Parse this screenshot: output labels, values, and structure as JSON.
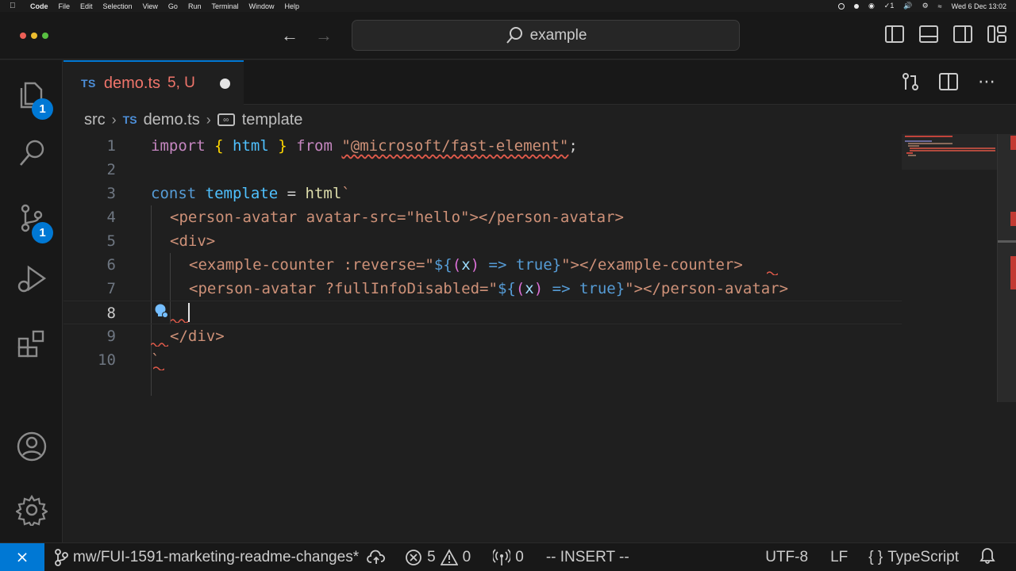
{
  "menubar": {
    "items": [
      "Code",
      "File",
      "Edit",
      "Selection",
      "View",
      "Go",
      "Run",
      "Terminal",
      "Window",
      "Help"
    ],
    "count_badge": "1",
    "datetime": "Wed 6 Dec  13:02"
  },
  "titlebar": {
    "search_text": "example"
  },
  "activity": {
    "explorer_badge": "1",
    "scm_badge": "1"
  },
  "tab": {
    "lang": "TS",
    "filename": "demo.ts",
    "status": "5, U"
  },
  "breadcrumb": {
    "folder": "src",
    "lang": "TS",
    "file": "demo.ts",
    "symbol": "template"
  },
  "editor": {
    "line_numbers": [
      "1",
      "2",
      "3",
      "4",
      "5",
      "6",
      "7",
      "8",
      "9",
      "10"
    ],
    "active_line": "8",
    "lines": {
      "l1": {
        "t1": "import",
        "t2": "{",
        "t3": "html",
        "t4": "}",
        "t5": "from",
        "t6": "\"@microsoft/fast-element\"",
        "t7": ";"
      },
      "l3": {
        "t1": "const",
        "t2": "template",
        "t3": "=",
        "t4": "html",
        "t5": "`"
      },
      "l4": {
        "t1": "<person-avatar avatar-src=\"hello\"></person-avatar>"
      },
      "l5": {
        "t1": "<div>"
      },
      "l6": {
        "t1": "<example-counter :reverse=\"",
        "t2": "${",
        "t3": "(",
        "t4": "x",
        "t5": ")",
        "t6": " => ",
        "t7": "true",
        "t8": "}",
        "t9": "\"></example-counter>"
      },
      "l7": {
        "t1": "<person-avatar ?fullInfoDisabled=\"",
        "t2": "${",
        "t3": "(",
        "t4": "x",
        "t5": ")",
        "t6": " => ",
        "t7": "true",
        "t8": "}",
        "t9": "\"></person-avatar>"
      },
      "l9": {
        "t1": "</div>"
      },
      "l10": {
        "t1": "`"
      }
    }
  },
  "statusbar": {
    "branch": "mw/FUI-1591-marketing-readme-changes*",
    "errors": "5",
    "warnings": "0",
    "ports": "0",
    "mode": "-- INSERT --",
    "encoding": "UTF-8",
    "eol": "LF",
    "language": "TypeScript"
  },
  "colors": {
    "accent": "#0078d4",
    "error": "#e05a4a",
    "modified_tab": "#f0756b"
  }
}
